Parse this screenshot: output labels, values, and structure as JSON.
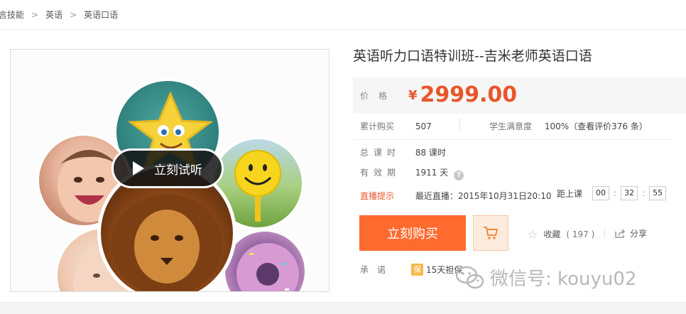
{
  "breadcrumb": {
    "items": [
      "言技能",
      "英语",
      "英语口语"
    ],
    "separator": ">"
  },
  "media": {
    "play_label": "立刻试听"
  },
  "course": {
    "title": "英语听力口语特训班--吉米老师英语口语",
    "price_label": "价格",
    "currency": "¥",
    "price": "2999.00",
    "purchases_label": "累计购买",
    "purchases": "507",
    "satisfaction_label": "学生满意度",
    "satisfaction": "100%（查看评价376 条）",
    "hours_label": "总课时",
    "hours": "88 课时",
    "validity_label": "有效期",
    "validity": "1911 天",
    "live_label": "直播提示",
    "live_text": "最近直播：2015年10月31日20:10",
    "countdown_label": "距上课",
    "countdown": [
      "00",
      "32",
      "55"
    ],
    "buy_label": "立刻购买",
    "favorite_label": "收藏",
    "favorite_count": "( 197 )",
    "share_label": "分享",
    "promise_label": "承　诺",
    "guarantee_icon_text": "保",
    "guarantee_text": "15天担保"
  },
  "watermark": "微信号: kouyu02",
  "colors": {
    "accent": "#ff6a2e",
    "price": "#e8562a",
    "cart_bg": "#fdecdd"
  }
}
